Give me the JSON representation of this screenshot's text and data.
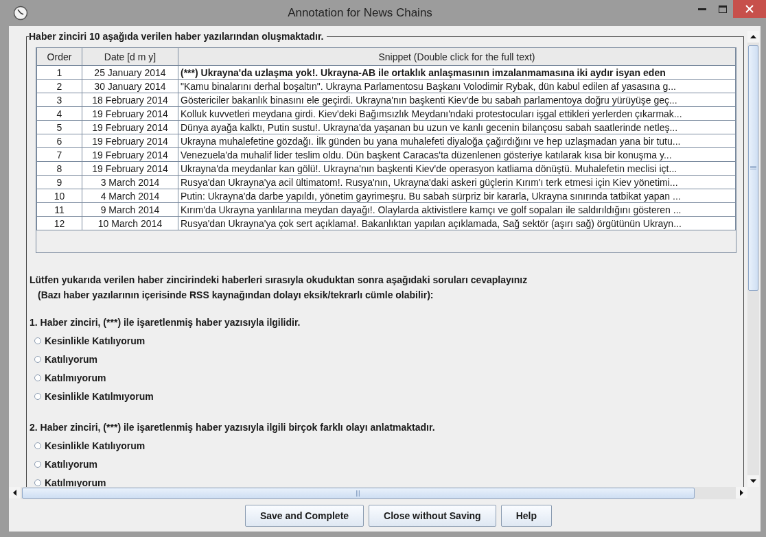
{
  "window": {
    "title": "Annotation for News Chains"
  },
  "group": {
    "title": "Haber zinciri 10 aşağıda verilen haber yazılarından oluşmaktadır."
  },
  "table": {
    "columns": [
      "Order",
      "Date [d m y]",
      "Snippet (Double click for the full text)"
    ],
    "rows": [
      {
        "order": "1",
        "date": "25 January 2014",
        "snippet": "(***) Ukrayna'da uzlaşma yok!. Ukrayna-AB ile ortaklık anlaşmasının imzalanmamasına iki aydır isyan eden",
        "marked": true
      },
      {
        "order": "2",
        "date": "30 January 2014",
        "snippet": "\"Kamu binalarını derhal boşaltın\". Ukrayna Parlamentosu Başkanı Volodimir Rybak, dün kabul edilen af yasasına g...",
        "marked": false
      },
      {
        "order": "3",
        "date": "18 February 2014",
        "snippet": "Göstericiler bakanlık binasını ele geçirdi. Ukrayna'nın başkenti Kiev'de bu sabah parlamentoya doğru yürüyüşe geç...",
        "marked": false
      },
      {
        "order": "4",
        "date": "19 February 2014",
        "snippet": "Kolluk kuvvetleri meydana girdi. Kiev'deki Bağımsızlık Meydanı'ndaki protestocuları işgal ettikleri yerlerden çıkarmak...",
        "marked": false
      },
      {
        "order": "5",
        "date": "19 February 2014",
        "snippet": "Dünya ayağa kalktı, Putin sustu!. Ukrayna'da yaşanan bu uzun ve kanlı gecenin bilançosu sabah saatlerinde netleş...",
        "marked": false
      },
      {
        "order": "6",
        "date": "19 February 2014",
        "snippet": "Ukrayna muhalefetine gözdağı. İlk günden bu yana muhalefeti diyaloğa çağırdığını ve hep uzlaşmadan yana bir tutu...",
        "marked": false
      },
      {
        "order": "7",
        "date": "19 February 2014",
        "snippet": "Venezuela'da muhalif lider teslim oldu. Dün başkent Caracas'ta düzenlenen gösteriye katılarak kısa bir konuşma y...",
        "marked": false
      },
      {
        "order": "8",
        "date": "19 February 2014",
        "snippet": "Ukrayna'da meydanlar kan gölü!. Ukrayna'nın başkenti Kiev'de operasyon katliama dönüştü. Muhalefetin meclisi içt...",
        "marked": false
      },
      {
        "order": "9",
        "date": "3 March 2014",
        "snippet": "Rusya'dan Ukrayna'ya acil ültimatom!. Rusya'nın, Ukrayna'daki askeri güçlerin Kırım'ı terk etmesi için Kiev yönetimi...",
        "marked": false
      },
      {
        "order": "10",
        "date": "4 March 2014",
        "snippet": "Putin: Ukrayna'da darbe yapıldı, yönetim gayrimeşru. Bu sabah sürpriz bir kararla, Ukrayna sınırında tatbikat yapan ...",
        "marked": false
      },
      {
        "order": "11",
        "date": "9 March 2014",
        "snippet": "Kırım'da Ukrayna yanlılarına meydan dayağı!. Olaylarda aktivistlere kamçı ve golf sopaları ile saldırıldığını gösteren ...",
        "marked": false
      },
      {
        "order": "12",
        "date": "10 March 2014",
        "snippet": "Rusya'dan Ukrayna'ya çok sert açıklama!. Bakanlıktan yapılan açıklamada, Sağ sektör (aşırı sağ) örgütünün Ukrayn...",
        "marked": false
      }
    ]
  },
  "instructions": [
    "Lütfen yukarıda verilen haber zincirindeki haberleri sırasıyla okuduktan sonra aşağıdaki soruları cevaplayınız",
    "(Bazı haber yazılarının içerisinde RSS kaynağından dolayı eksik/tekrarlı cümle olabilir):"
  ],
  "questions": [
    {
      "text": "1. Haber zinciri, (***) ile işaretlenmiş haber yazısıyla ilgilidir.",
      "options": [
        {
          "label": "Kesinlikle Katılıyorum",
          "selected": false
        },
        {
          "label": "Katılıyorum",
          "selected": false
        },
        {
          "label": "Katılmıyorum",
          "selected": false
        },
        {
          "label": "Kesinlikle Katılmıyorum",
          "selected": false
        }
      ]
    },
    {
      "text": "2. Haber zinciri, (***) ile işaretlenmiş haber yazısıyla ilgili birçok farklı olayı anlatmaktadır.",
      "options": [
        {
          "label": "Kesinlikle Katılıyorum",
          "selected": false
        },
        {
          "label": "Katılıyorum",
          "selected": false
        },
        {
          "label": "Katılmıyorum",
          "selected": false
        }
      ]
    }
  ],
  "buttons": [
    "Save and Complete",
    "Close without Saving",
    "Help"
  ]
}
